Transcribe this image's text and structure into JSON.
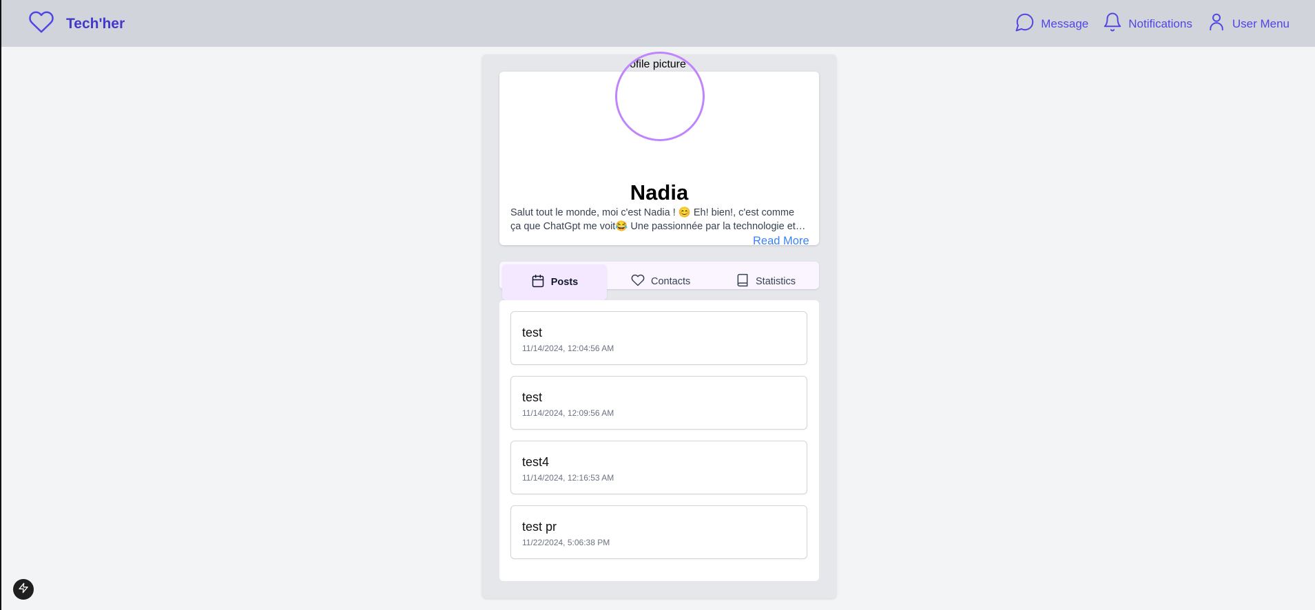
{
  "nav": {
    "brand": "Tech'her",
    "items": [
      {
        "label": "Message",
        "icon": "message-circle-icon"
      },
      {
        "label": "Notifications",
        "icon": "bell-icon"
      },
      {
        "label": "User Menu",
        "icon": "user-icon"
      }
    ]
  },
  "profile": {
    "avatar_alt": "Profile picture",
    "name": "Nadia",
    "bio": "Salut tout le monde, moi c'est Nadia ! 😊 Eh! bien!, c'est comme ça que ChatGpt me voit😂 Une passionnée par la technologie et les…",
    "read_more": "Read More"
  },
  "tabs": [
    {
      "label": "Posts",
      "icon": "calendar-icon",
      "active": true
    },
    {
      "label": "Contacts",
      "icon": "heart-icon",
      "active": false
    },
    {
      "label": "Statistics",
      "icon": "book-icon",
      "active": false
    }
  ],
  "posts": [
    {
      "title": "test",
      "date": "11/14/2024, 12:04:56 AM"
    },
    {
      "title": "test",
      "date": "11/14/2024, 12:09:56 AM"
    },
    {
      "title": "test4",
      "date": "11/14/2024, 12:16:53 AM"
    },
    {
      "title": "test pr",
      "date": "11/22/2024, 5:06:38 PM"
    }
  ],
  "colors": {
    "brand": "#4338ca",
    "nav_bg": "#d1d5db",
    "avatar_ring": "#c084fc",
    "link": "#3b82f6",
    "active_tab_bg": "#f3e8ff"
  }
}
